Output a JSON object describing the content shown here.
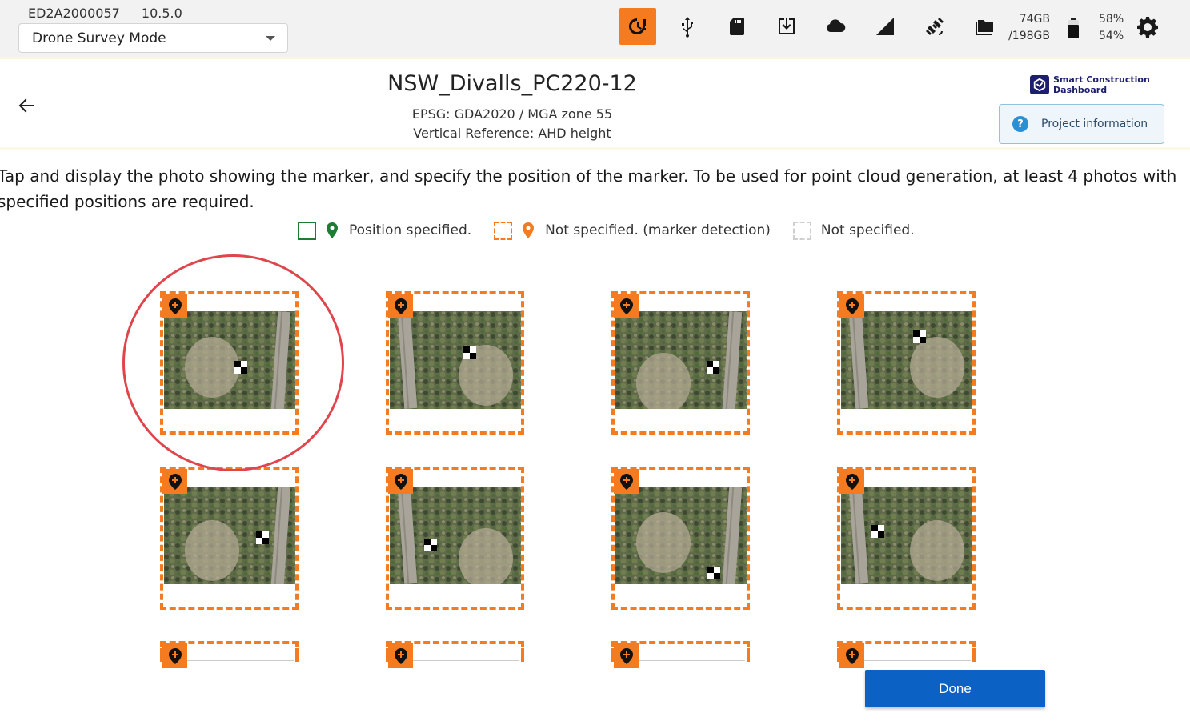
{
  "status_bar": {
    "device_id": "ED2A2000057",
    "version": "10.5.0",
    "mode": "Drone Survey Mode",
    "tray_icons": [
      "alert-timer-icon",
      "usb-icon",
      "sd-card-icon",
      "download-icon",
      "cloud-icon",
      "signal-icon",
      "satellite-icon",
      "folders-icon"
    ],
    "storage_free": "74GB",
    "storage_total": "/198GB",
    "battery_top": "58%",
    "battery_bottom": "54%"
  },
  "header": {
    "title": "NSW_Divalls_PC220-12",
    "epsg": "EPSG: GDA2020 / MGA zone 55",
    "vertical_reference": "Vertical Reference: AHD height",
    "logo_line1": "Smart Construction",
    "logo_line2": "Dashboard",
    "project_info_label": "Project information"
  },
  "instruction": "Tap and display the photo showing the marker, and specify the position of the marker. To be used for point cloud generation, at least 4 photos with specified positions are required.",
  "legend": {
    "specified": "Position specified.",
    "marker_detection": "Not specified. (marker detection)",
    "not_specified": "Not specified."
  },
  "photos": [
    {
      "status": "not-specified-marker-detection"
    },
    {
      "status": "not-specified-marker-detection"
    },
    {
      "status": "not-specified-marker-detection"
    },
    {
      "status": "not-specified-marker-detection"
    },
    {
      "status": "not-specified-marker-detection"
    },
    {
      "status": "not-specified-marker-detection"
    },
    {
      "status": "not-specified-marker-detection"
    },
    {
      "status": "not-specified-marker-detection"
    },
    {
      "status": "not-specified-marker-detection"
    },
    {
      "status": "not-specified-marker-detection"
    },
    {
      "status": "not-specified-marker-detection"
    },
    {
      "status": "not-specified-marker-detection"
    }
  ],
  "done_label": "Done",
  "colors": {
    "accent_orange": "#f47b20",
    "specified_green": "#1c7d33",
    "primary_blue": "#0b62c4",
    "highlight_red": "#e0454c"
  }
}
